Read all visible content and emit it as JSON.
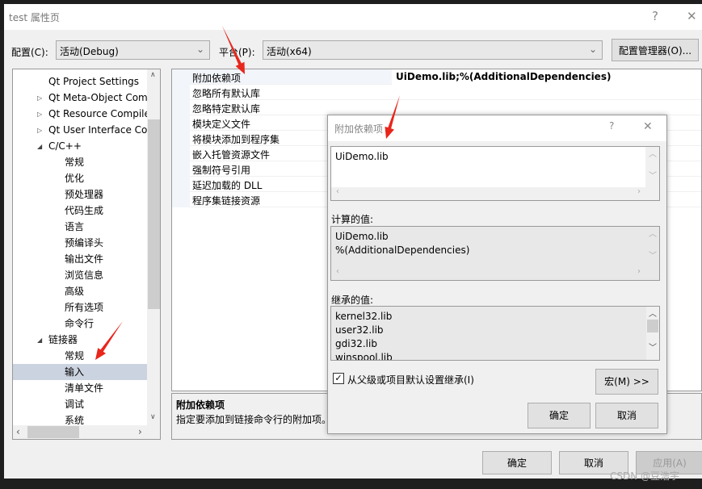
{
  "window": {
    "title": "test 属性页",
    "help": "?",
    "close": "✕"
  },
  "toolbar": {
    "config_label": "配置(C):",
    "config_value": "活动(Debug)",
    "platform_label": "平台(P):",
    "platform_value": "活动(x64)",
    "config_manager": "配置管理器(O)..."
  },
  "tree": {
    "items": [
      {
        "label": "Qt Project Settings",
        "level": 1,
        "expander": ""
      },
      {
        "label": "Qt Meta-Object Com",
        "level": 1,
        "expander": "collapsed"
      },
      {
        "label": "Qt Resource Compile",
        "level": 1,
        "expander": "collapsed"
      },
      {
        "label": "Qt User Interface Cor",
        "level": 1,
        "expander": "collapsed"
      },
      {
        "label": "C/C++",
        "level": 1,
        "expander": "expanded"
      },
      {
        "label": "常规",
        "level": 2
      },
      {
        "label": "优化",
        "level": 2
      },
      {
        "label": "预处理器",
        "level": 2
      },
      {
        "label": "代码生成",
        "level": 2
      },
      {
        "label": "语言",
        "level": 2
      },
      {
        "label": "预编译头",
        "level": 2
      },
      {
        "label": "输出文件",
        "level": 2
      },
      {
        "label": "浏览信息",
        "level": 2
      },
      {
        "label": "高级",
        "level": 2
      },
      {
        "label": "所有选项",
        "level": 2
      },
      {
        "label": "命令行",
        "level": 2
      },
      {
        "label": "链接器",
        "level": 1,
        "expander": "expanded"
      },
      {
        "label": "常规",
        "level": 2
      },
      {
        "label": "输入",
        "level": 2,
        "selected": true
      },
      {
        "label": "清单文件",
        "level": 2
      },
      {
        "label": "调试",
        "level": 2
      },
      {
        "label": "系统",
        "level": 2
      }
    ]
  },
  "grid": {
    "rows": [
      {
        "name": "附加依赖项",
        "value": "UiDemo.lib;%(AdditionalDependencies)"
      },
      {
        "name": "忽略所有默认库",
        "value": ""
      },
      {
        "name": "忽略特定默认库",
        "value": ""
      },
      {
        "name": "模块定义文件",
        "value": ""
      },
      {
        "name": "将模块添加到程序集",
        "value": ""
      },
      {
        "name": "嵌入托管资源文件",
        "value": ""
      },
      {
        "name": "强制符号引用",
        "value": ""
      },
      {
        "name": "延迟加载的 DLL",
        "value": ""
      },
      {
        "name": "程序集链接资源",
        "value": ""
      }
    ]
  },
  "description": {
    "title": "附加依赖项",
    "text": "指定要添加到链接命令行的附加项。"
  },
  "buttons": {
    "ok": "确定",
    "cancel": "取消",
    "apply": "应用(A)"
  },
  "watermark": "CSDN @豆浩宇",
  "subdialog": {
    "title": "附加依赖项",
    "help": "?",
    "close": "✕",
    "edit_lines": [
      "UiDemo.lib"
    ],
    "computed_label": "计算的值:",
    "computed_lines": [
      "UiDemo.lib",
      "%(AdditionalDependencies)"
    ],
    "inherited_label": "继承的值:",
    "inherited_lines": [
      "kernel32.lib",
      "user32.lib",
      "gdi32.lib",
      "winspool.lib"
    ],
    "inherit_checkbox": "从父级或项目默认设置继承(I)",
    "inherit_checked": true,
    "macro": "宏(M) >>",
    "ok": "确定",
    "cancel": "取消"
  },
  "colors": {
    "annotation_arrow": "#e8261b",
    "selection": "#ccd3e0"
  }
}
